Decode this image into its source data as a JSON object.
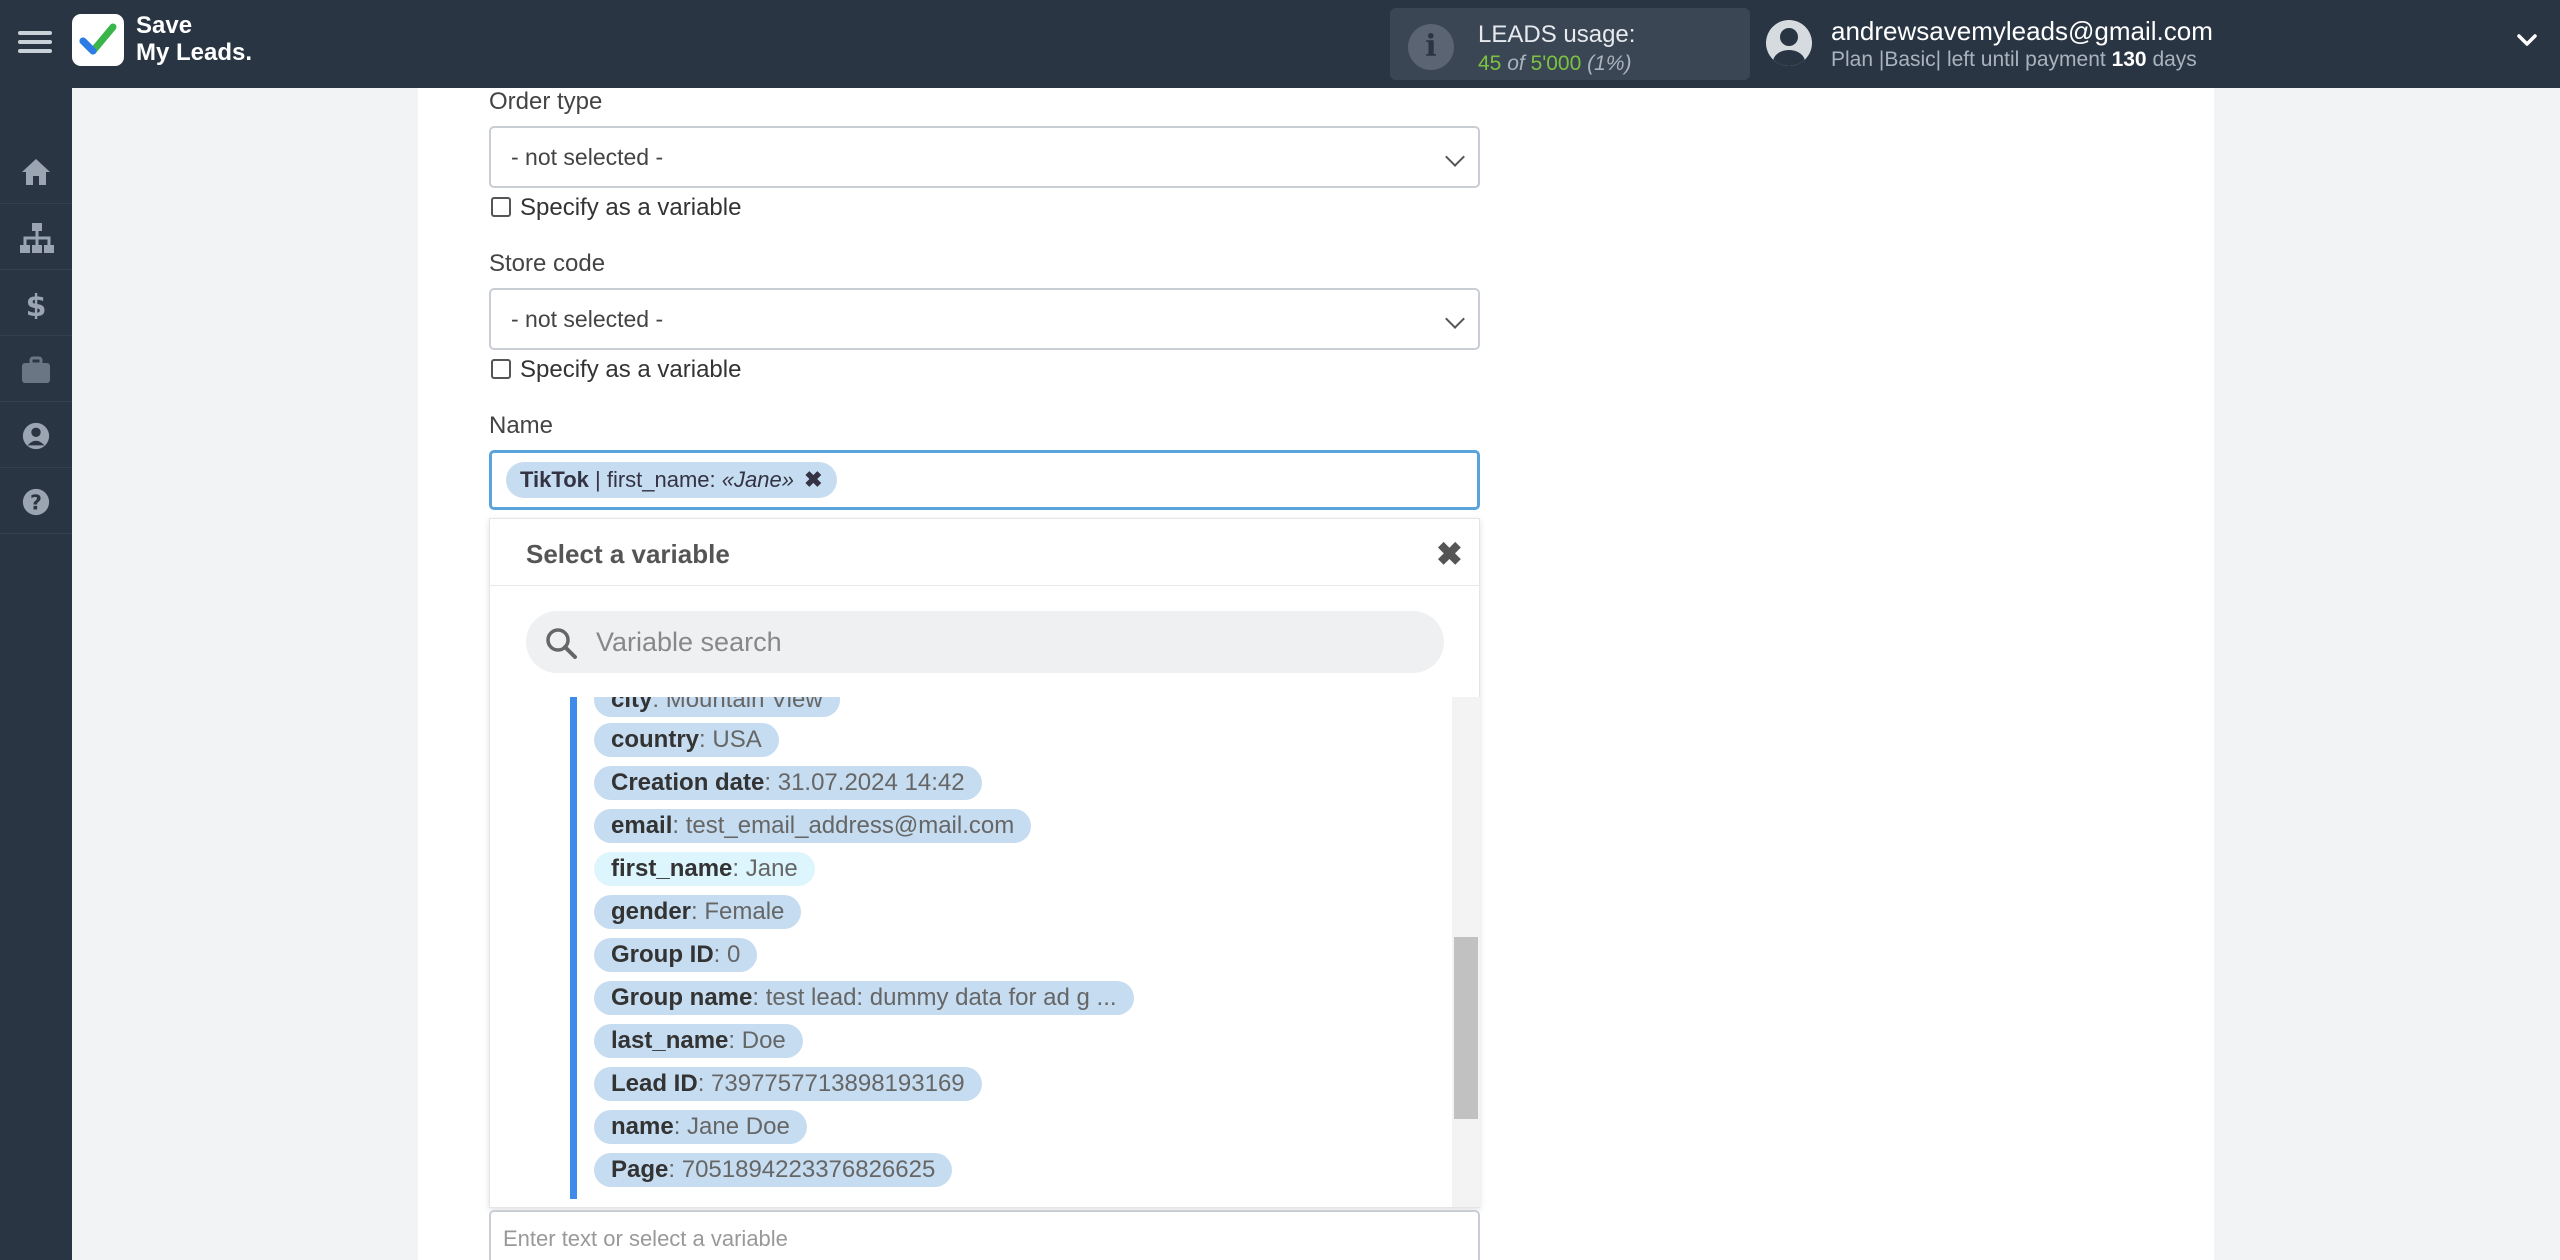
{
  "header": {
    "logo_line1": "Save",
    "logo_line2": "My Leads.",
    "usage_label": "LEADS usage:",
    "usage_used": "45",
    "usage_of": "of",
    "usage_total": "5'000",
    "usage_pct": "(1%)",
    "user_email": "andrewsavemyleads@gmail.com",
    "plan_prefix": "Plan |Basic| left until payment",
    "plan_days": "130",
    "plan_suffix": "days"
  },
  "sidebar": {
    "items": [
      "home-icon",
      "sitemap-icon",
      "dollar-icon",
      "briefcase-icon",
      "user-icon",
      "help-icon"
    ]
  },
  "form": {
    "order_type": {
      "label": "Order type",
      "value": "- not selected -",
      "checkbox_label": "Specify as a variable"
    },
    "store_code": {
      "label": "Store code",
      "value": "- not selected -",
      "checkbox_label": "Specify as a variable"
    },
    "name": {
      "label": "Name",
      "tag_source": "TikTok",
      "tag_sep": " | ",
      "tag_field": "first_name:",
      "tag_value": "«Jane»",
      "tag_remove": "✖"
    },
    "next_field_placeholder": "Enter text or select a variable"
  },
  "variable_picker": {
    "title": "Select a variable",
    "close": "✖",
    "search_placeholder": "Variable search",
    "variables": [
      {
        "key": "city",
        "value": "Mountain View"
      },
      {
        "key": "country",
        "value": "USA"
      },
      {
        "key": "Creation date",
        "value": "31.07.2024 14:42"
      },
      {
        "key": "email",
        "value": "test_email_address@mail.com"
      },
      {
        "key": "first_name",
        "value": "Jane"
      },
      {
        "key": "gender",
        "value": "Female"
      },
      {
        "key": "Group ID",
        "value": "0"
      },
      {
        "key": "Group name",
        "value": "test lead: dummy data for ad g ..."
      },
      {
        "key": "last_name",
        "value": "Doe"
      },
      {
        "key": "Lead ID",
        "value": "7397757713898193169"
      },
      {
        "key": "name",
        "value": "Jane Doe"
      },
      {
        "key": "Page",
        "value": "7051894223376826625"
      }
    ]
  }
}
